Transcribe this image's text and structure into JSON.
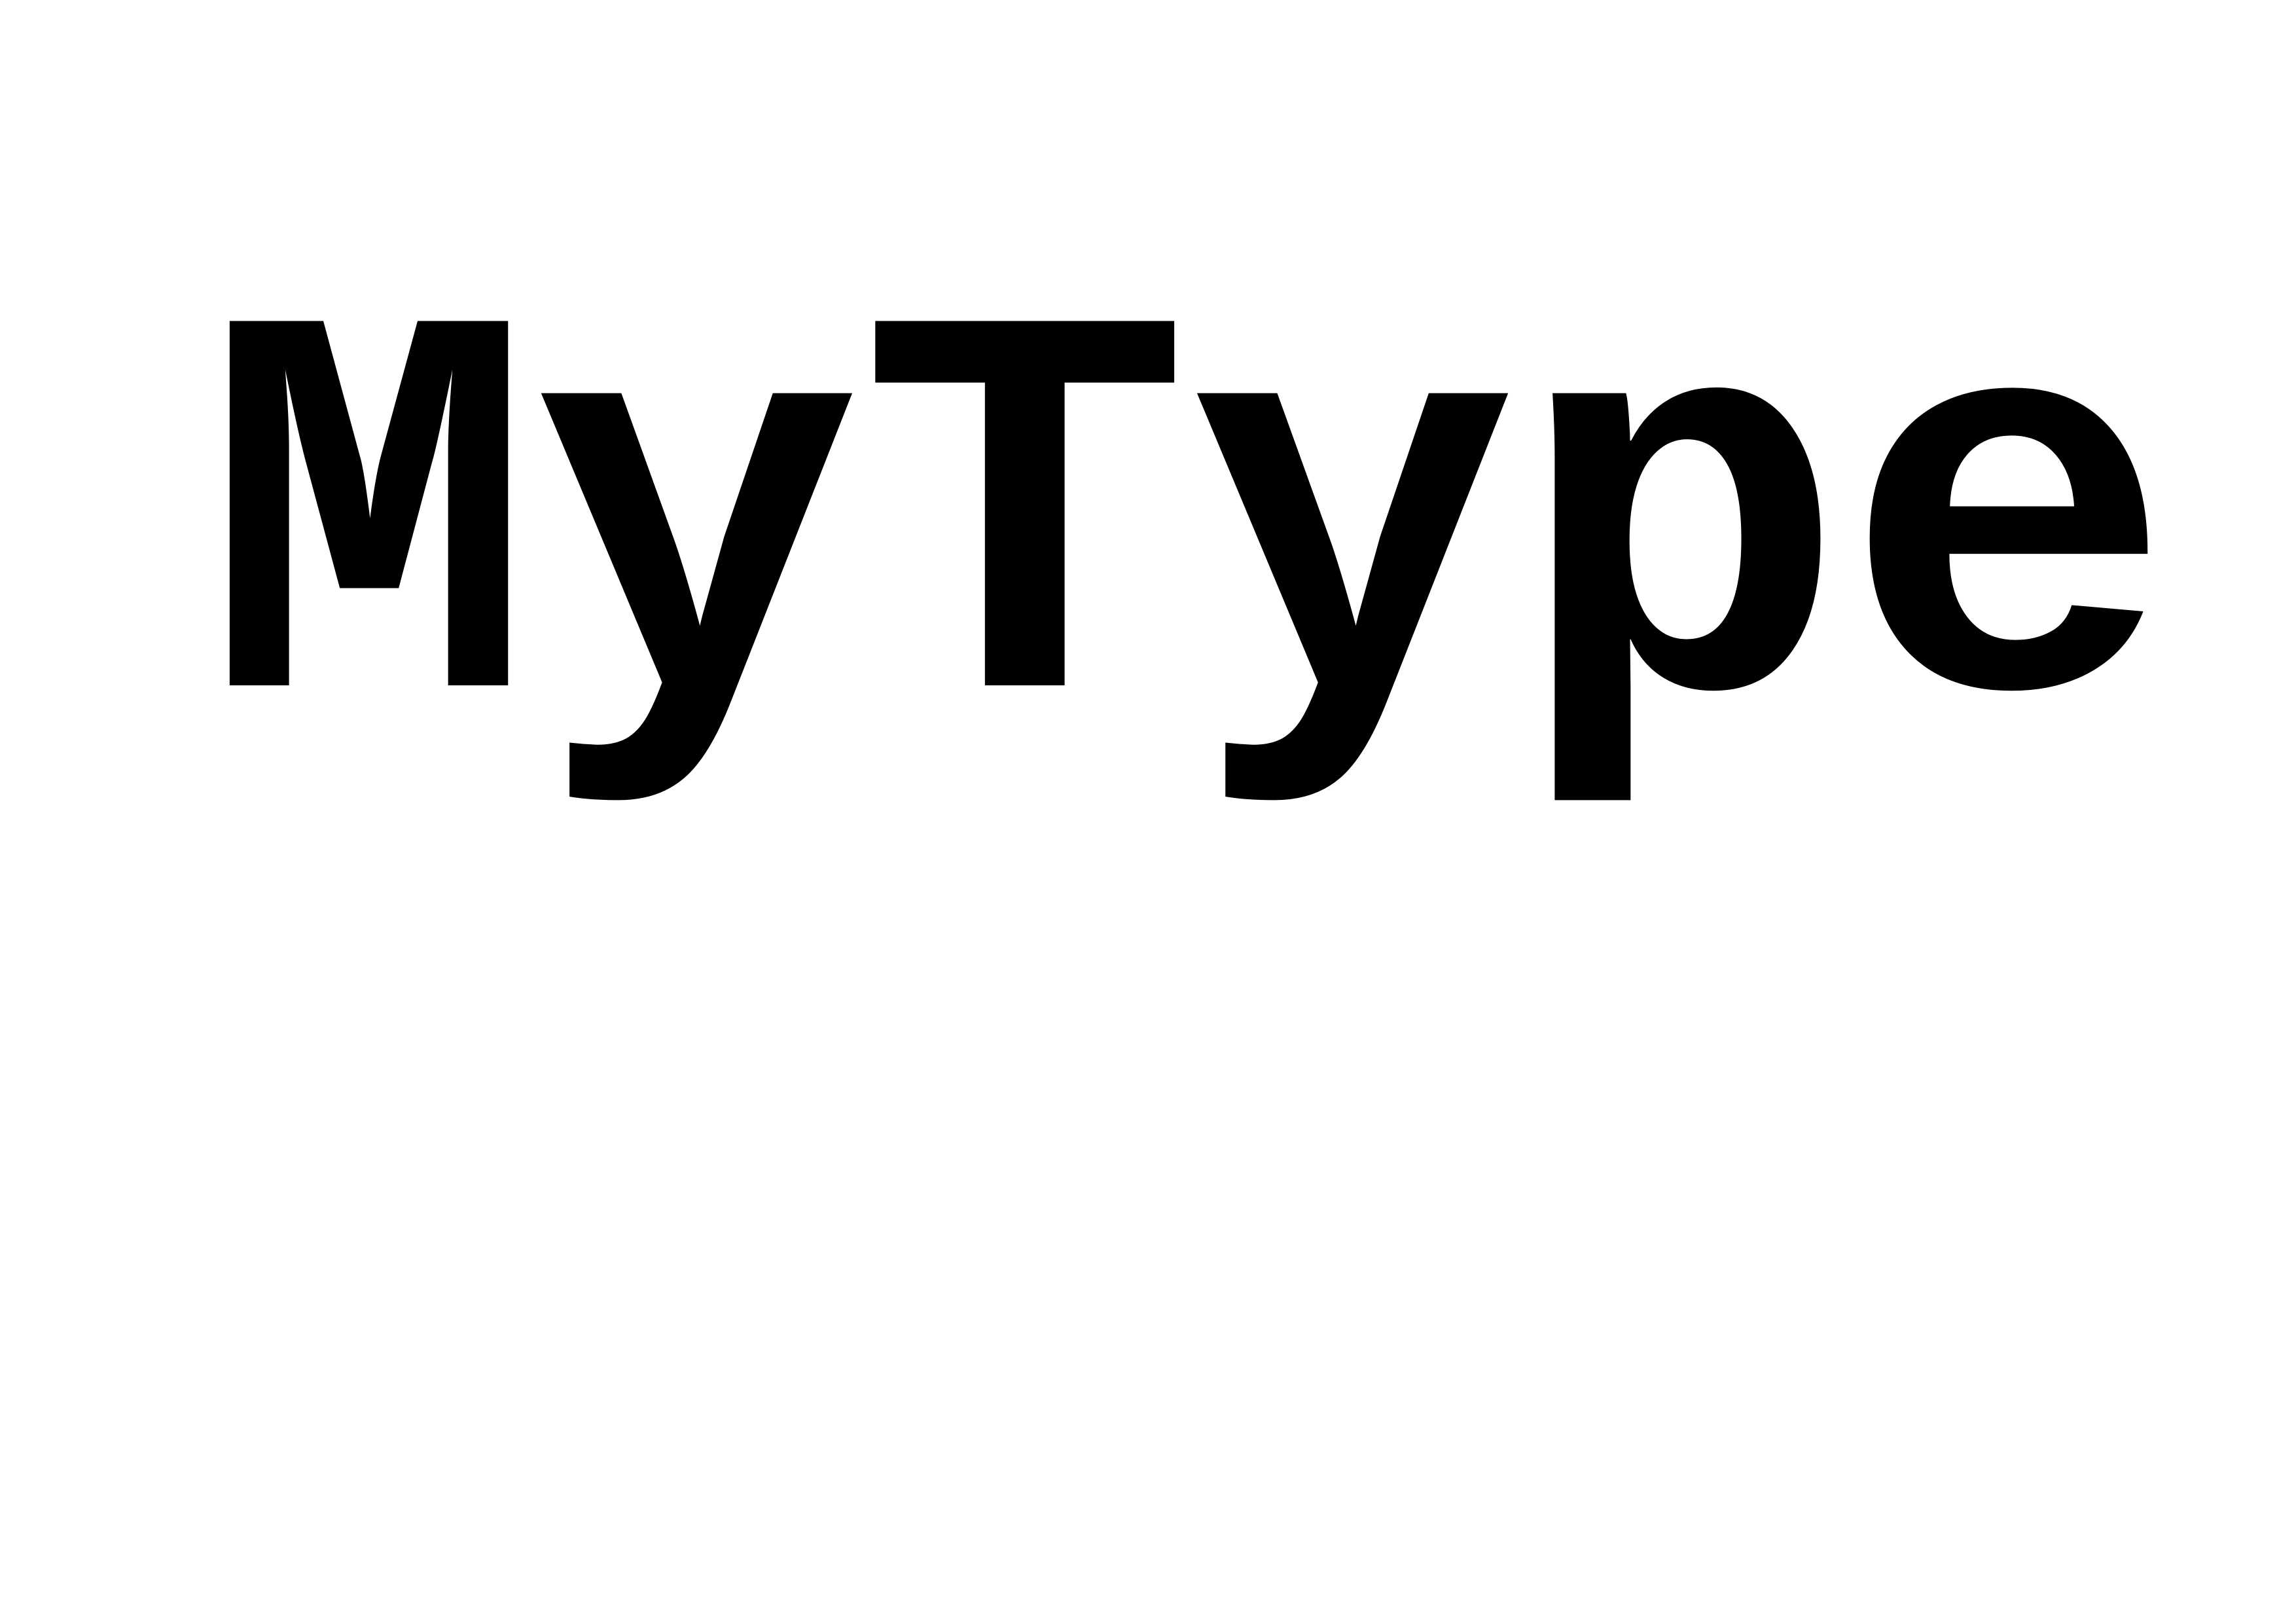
{
  "page": {
    "background_color": "#ffffff",
    "text_color": "#000000",
    "wordmark": "MyType"
  }
}
